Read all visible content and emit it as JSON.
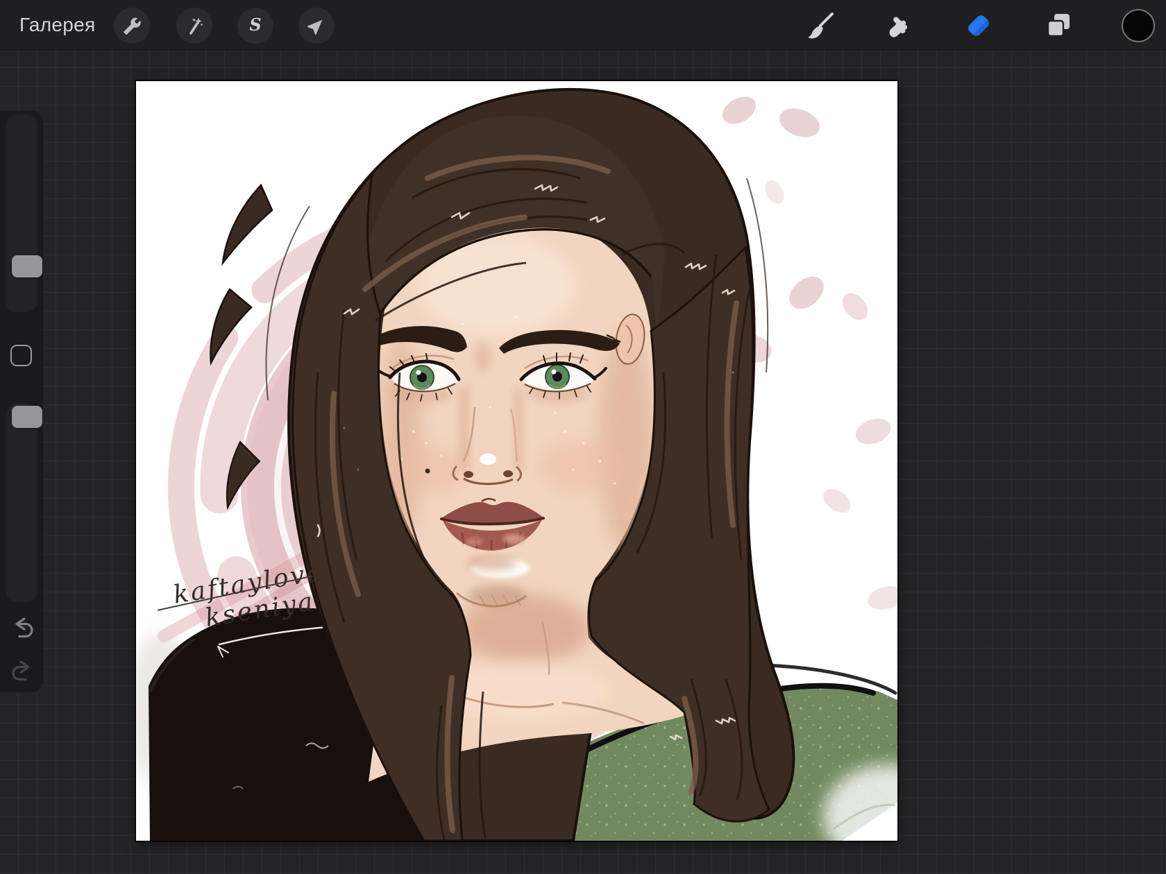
{
  "toolbar": {
    "gallery_label": "Галерея",
    "left_tools": [
      {
        "id": "actions",
        "icon": "wrench-icon"
      },
      {
        "id": "adjustments",
        "icon": "magic-wand-icon"
      },
      {
        "id": "selection",
        "icon": "selection-s-icon"
      },
      {
        "id": "transform",
        "icon": "transform-arrow-icon"
      }
    ],
    "right_tools": [
      {
        "id": "brush",
        "icon": "paintbrush-icon",
        "active": false
      },
      {
        "id": "smudge",
        "icon": "smudge-finger-icon",
        "active": false
      },
      {
        "id": "eraser",
        "icon": "eraser-icon",
        "active": true
      },
      {
        "id": "layers",
        "icon": "layers-icon",
        "active": false
      },
      {
        "id": "color",
        "icon": "color-swatch",
        "swatch_color": "#060606"
      }
    ],
    "active_tool_color": "#2478f2"
  },
  "sidebar": {
    "size_slider": {
      "handle_fraction_from_top": 0.72
    },
    "opacity_slider": {
      "handle_fraction_from_top": 0.02
    },
    "modify_button": {
      "shape": "rounded-square"
    },
    "undo_enabled": true,
    "redo_enabled": false
  },
  "canvas": {
    "background_color": "#ffffff",
    "artwork": {
      "subject": "stylized portrait of a woman with long dark brown hair, green eyes, green sweater and black top, rose scribble background with petals",
      "signature_line1": "kaftaylova",
      "signature_line2": "kseniya",
      "palette": {
        "hair": "#3a2a22",
        "hair_outline": "#1b110c",
        "skin": "#f2d5c0",
        "lips": "#9a544c",
        "iris_green": "#5d8a5c",
        "sweater_green": "#72895f",
        "top_black": "#17100d",
        "rose_scribble": "#c4757c",
        "petal_pink": "#e9d2d4"
      }
    }
  },
  "theme": {
    "toolbar_bg": "#1f1f21",
    "workspace_bg": "#242427",
    "grid_line": "#2e2e31",
    "panel_bg": "#1a1a1c",
    "icon_color": "#bfbfc1",
    "text_color": "#d6d6d8"
  }
}
